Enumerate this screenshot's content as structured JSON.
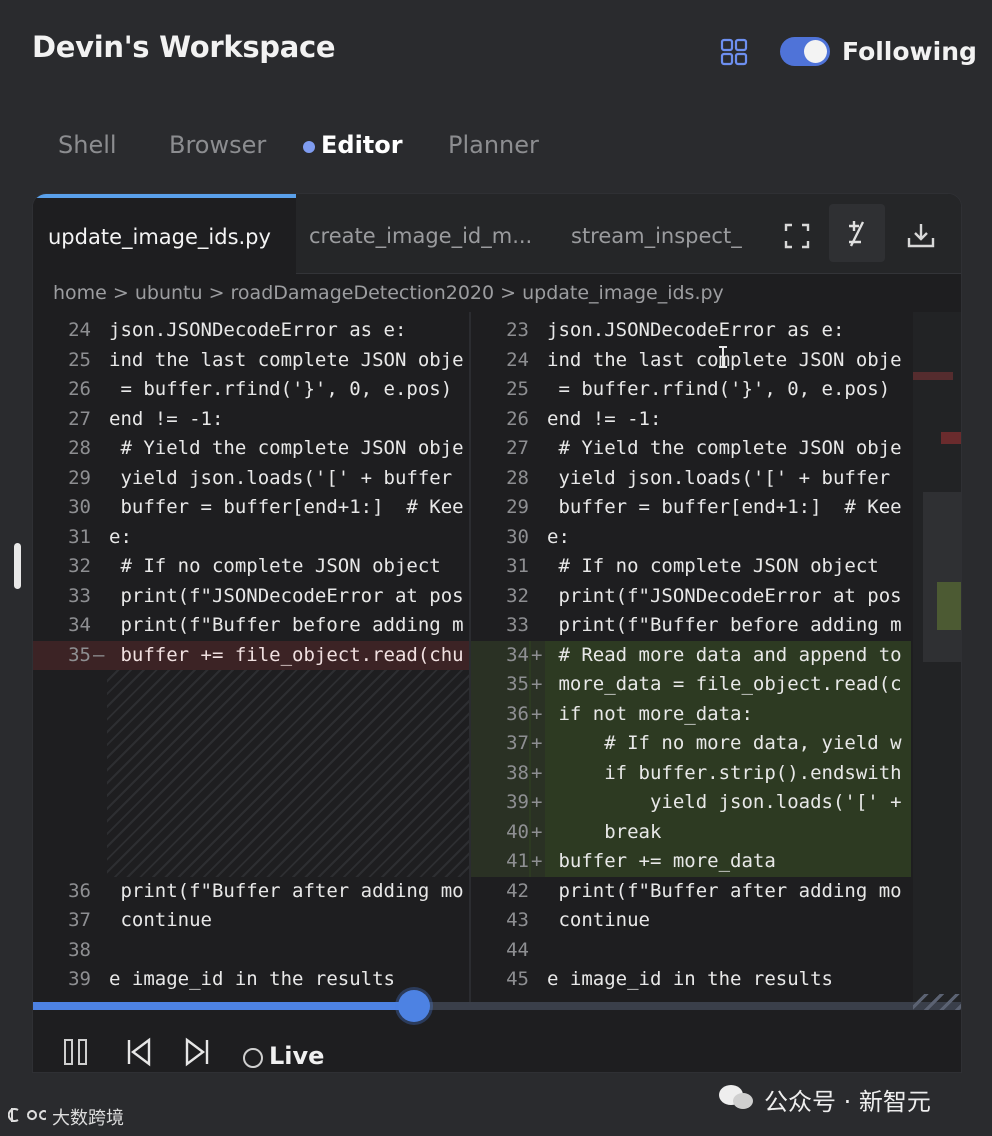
{
  "header": {
    "title": "Devin's Workspace",
    "following_label": "Following",
    "following_on": true
  },
  "tabs": [
    {
      "label": "Shell",
      "active": false
    },
    {
      "label": "Browser",
      "active": false
    },
    {
      "label": "Editor",
      "active": true
    },
    {
      "label": "Planner",
      "active": false
    }
  ],
  "file_tabs": [
    {
      "label": "update_image_ids.py",
      "active": true
    },
    {
      "label": "create_image_id_m...",
      "active": false
    },
    {
      "label": "stream_inspect_",
      "active": false
    }
  ],
  "toolbar_icons": [
    "fullscreen-icon",
    "diff-toggle-icon",
    "download-icon"
  ],
  "breadcrumb": "home > ubuntu > roadDamageDetection2020 > update_image_ids.py",
  "left_lines": [
    {
      "n": "24",
      "m": "",
      "t": "json.JSONDecodeError as e:",
      "type": ""
    },
    {
      "n": "25",
      "m": "",
      "t": "ind the last complete JSON obje",
      "type": ""
    },
    {
      "n": "26",
      "m": "",
      "t": " = buffer.rfind('}', 0, e.pos)",
      "type": ""
    },
    {
      "n": "27",
      "m": "",
      "t": "end != -1:",
      "type": ""
    },
    {
      "n": "28",
      "m": "",
      "t": " # Yield the complete JSON obje",
      "type": ""
    },
    {
      "n": "29",
      "m": "",
      "t": " yield json.loads('[' + buffer",
      "type": ""
    },
    {
      "n": "30",
      "m": "",
      "t": " buffer = buffer[end+1:]  # Kee",
      "type": ""
    },
    {
      "n": "31",
      "m": "",
      "t": "e:",
      "type": ""
    },
    {
      "n": "32",
      "m": "",
      "t": " # If no complete JSON object",
      "type": ""
    },
    {
      "n": "33",
      "m": "",
      "t": " print(f\"JSONDecodeError at pos",
      "type": ""
    },
    {
      "n": "34",
      "m": "",
      "t": " print(f\"Buffer before adding m",
      "type": ""
    },
    {
      "n": "35",
      "m": "—",
      "t": " buffer += file_object.read(chu",
      "type": "del"
    },
    {
      "n": "36",
      "m": "",
      "t": " print(f\"Buffer after adding mo",
      "type": ""
    },
    {
      "n": "37",
      "m": "",
      "t": " continue",
      "type": ""
    },
    {
      "n": "38",
      "m": "",
      "t": "",
      "type": ""
    },
    {
      "n": "39",
      "m": "",
      "t": "e image_id in the results",
      "type": ""
    }
  ],
  "right_lines": [
    {
      "n": "23",
      "m": "",
      "t": "json.JSONDecodeError as e:",
      "type": ""
    },
    {
      "n": "24",
      "m": "",
      "t": "ind the last complete JSON obje",
      "type": ""
    },
    {
      "n": "25",
      "m": "",
      "t": " = buffer.rfind('}', 0, e.pos)",
      "type": ""
    },
    {
      "n": "26",
      "m": "",
      "t": "end != -1:",
      "type": ""
    },
    {
      "n": "27",
      "m": "",
      "t": " # Yield the complete JSON obje",
      "type": ""
    },
    {
      "n": "28",
      "m": "",
      "t": " yield json.loads('[' + buffer",
      "type": ""
    },
    {
      "n": "29",
      "m": "",
      "t": " buffer = buffer[end+1:]  # Kee",
      "type": ""
    },
    {
      "n": "30",
      "m": "",
      "t": "e:",
      "type": ""
    },
    {
      "n": "31",
      "m": "",
      "t": " # If no complete JSON object",
      "type": ""
    },
    {
      "n": "32",
      "m": "",
      "t": " print(f\"JSONDecodeError at pos",
      "type": ""
    },
    {
      "n": "33",
      "m": "",
      "t": " print(f\"Buffer before adding m",
      "type": ""
    },
    {
      "n": "34",
      "m": "+",
      "t": " # Read more data and append to",
      "type": "add"
    },
    {
      "n": "35",
      "m": "+",
      "t": " more_data = file_object.read(c",
      "type": "add"
    },
    {
      "n": "36",
      "m": "+",
      "t": " if not more_data:",
      "type": "add"
    },
    {
      "n": "37",
      "m": "+",
      "t": "     # If no more data, yield w",
      "type": "add"
    },
    {
      "n": "38",
      "m": "+",
      "t": "     if buffer.strip().endswith",
      "type": "add"
    },
    {
      "n": "39",
      "m": "+",
      "t": "         yield json.loads('[' +",
      "type": "add"
    },
    {
      "n": "40",
      "m": "+",
      "t": "     break",
      "type": "add"
    },
    {
      "n": "41",
      "m": "+",
      "t": " buffer += more_data",
      "type": "add"
    },
    {
      "n": "42",
      "m": "",
      "t": " print(f\"Buffer after adding mo",
      "type": ""
    },
    {
      "n": "43",
      "m": "",
      "t": " continue",
      "type": ""
    },
    {
      "n": "44",
      "m": "",
      "t": "",
      "type": ""
    },
    {
      "n": "45",
      "m": "",
      "t": "e image_id in the results",
      "type": ""
    }
  ],
  "playback": {
    "progress": 0.41,
    "live_label": "Live"
  },
  "watermarks": {
    "right": "公众号 · 新智元",
    "left": "大数跨境"
  },
  "colors": {
    "accent": "#4d82e3",
    "deleted_bg": "#3c2325",
    "added_bg": "#2d3a22"
  }
}
